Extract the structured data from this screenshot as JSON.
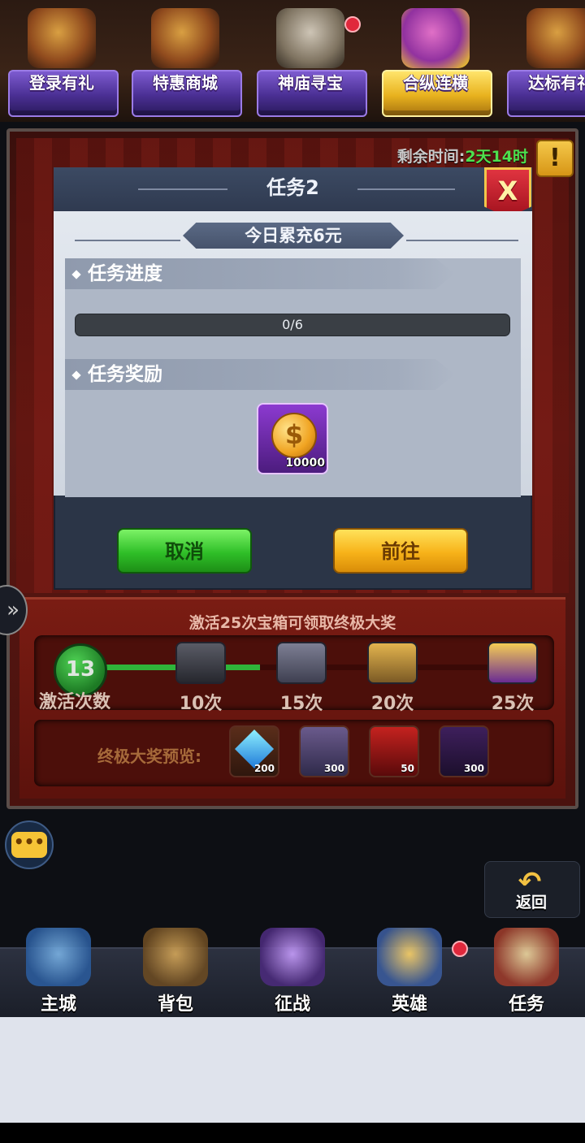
{
  "top_tabs": [
    {
      "label": "登录有礼",
      "active": false,
      "dot": false
    },
    {
      "label": "特惠商城",
      "active": false,
      "dot": false
    },
    {
      "label": "神庙寻宝",
      "active": false,
      "dot": true
    },
    {
      "label": "合纵连横",
      "active": true,
      "dot": false
    },
    {
      "label": "达标有礼",
      "active": false,
      "dot": false
    }
  ],
  "event": {
    "timer_label": "剩余时间:",
    "timer_value": "2天14时",
    "warning_glyph": "!",
    "hint": "激活25次宝箱可领取终极大奖",
    "activation_count": "13",
    "activation_label": "激活次数",
    "milestones": [
      "10次",
      "15次",
      "20次",
      "25次"
    ],
    "preview_label": "终极大奖预览:",
    "prizes": [
      {
        "icon": "diamond-icon",
        "amount": "200"
      },
      {
        "icon": "card-pack-icon",
        "amount": "300"
      },
      {
        "icon": "hero-shard-icon",
        "amount": "50"
      },
      {
        "icon": "beetle-relic-icon",
        "amount": "300"
      }
    ]
  },
  "modal": {
    "title": "任务2",
    "close_glyph": "X",
    "subtitle": "今日累充6元",
    "progress_section": "任务进度",
    "progress_text": "0/6",
    "progress_value": 0,
    "progress_max": 6,
    "reward_section": "任务奖励",
    "reward_icon": "gold-coin-icon",
    "reward_glyph": "$",
    "reward_amount": "10000",
    "cancel_label": "取消",
    "go_label": "前往"
  },
  "side": {
    "expand_glyph": "»",
    "chat_glyph": "•••",
    "back_glyph": "↶",
    "back_label": "返回"
  },
  "bottom_nav": [
    {
      "label": "主城",
      "icon": "castle-icon",
      "dot": false
    },
    {
      "label": "背包",
      "icon": "backpack-chest-icon",
      "dot": false
    },
    {
      "label": "征战",
      "icon": "dragon-portal-icon",
      "dot": false
    },
    {
      "label": "英雄",
      "icon": "hero-helmet-icon",
      "dot": true
    },
    {
      "label": "任务",
      "icon": "scroll-icon",
      "dot": false
    }
  ],
  "colors": {
    "timer_value": "#4ee04e",
    "progress_fill": "#4ee04e",
    "cancel_button": "#2fbf28",
    "go_button": "#f7b219",
    "close_button": "#c8202e",
    "active_tab": "#e8b21e"
  }
}
